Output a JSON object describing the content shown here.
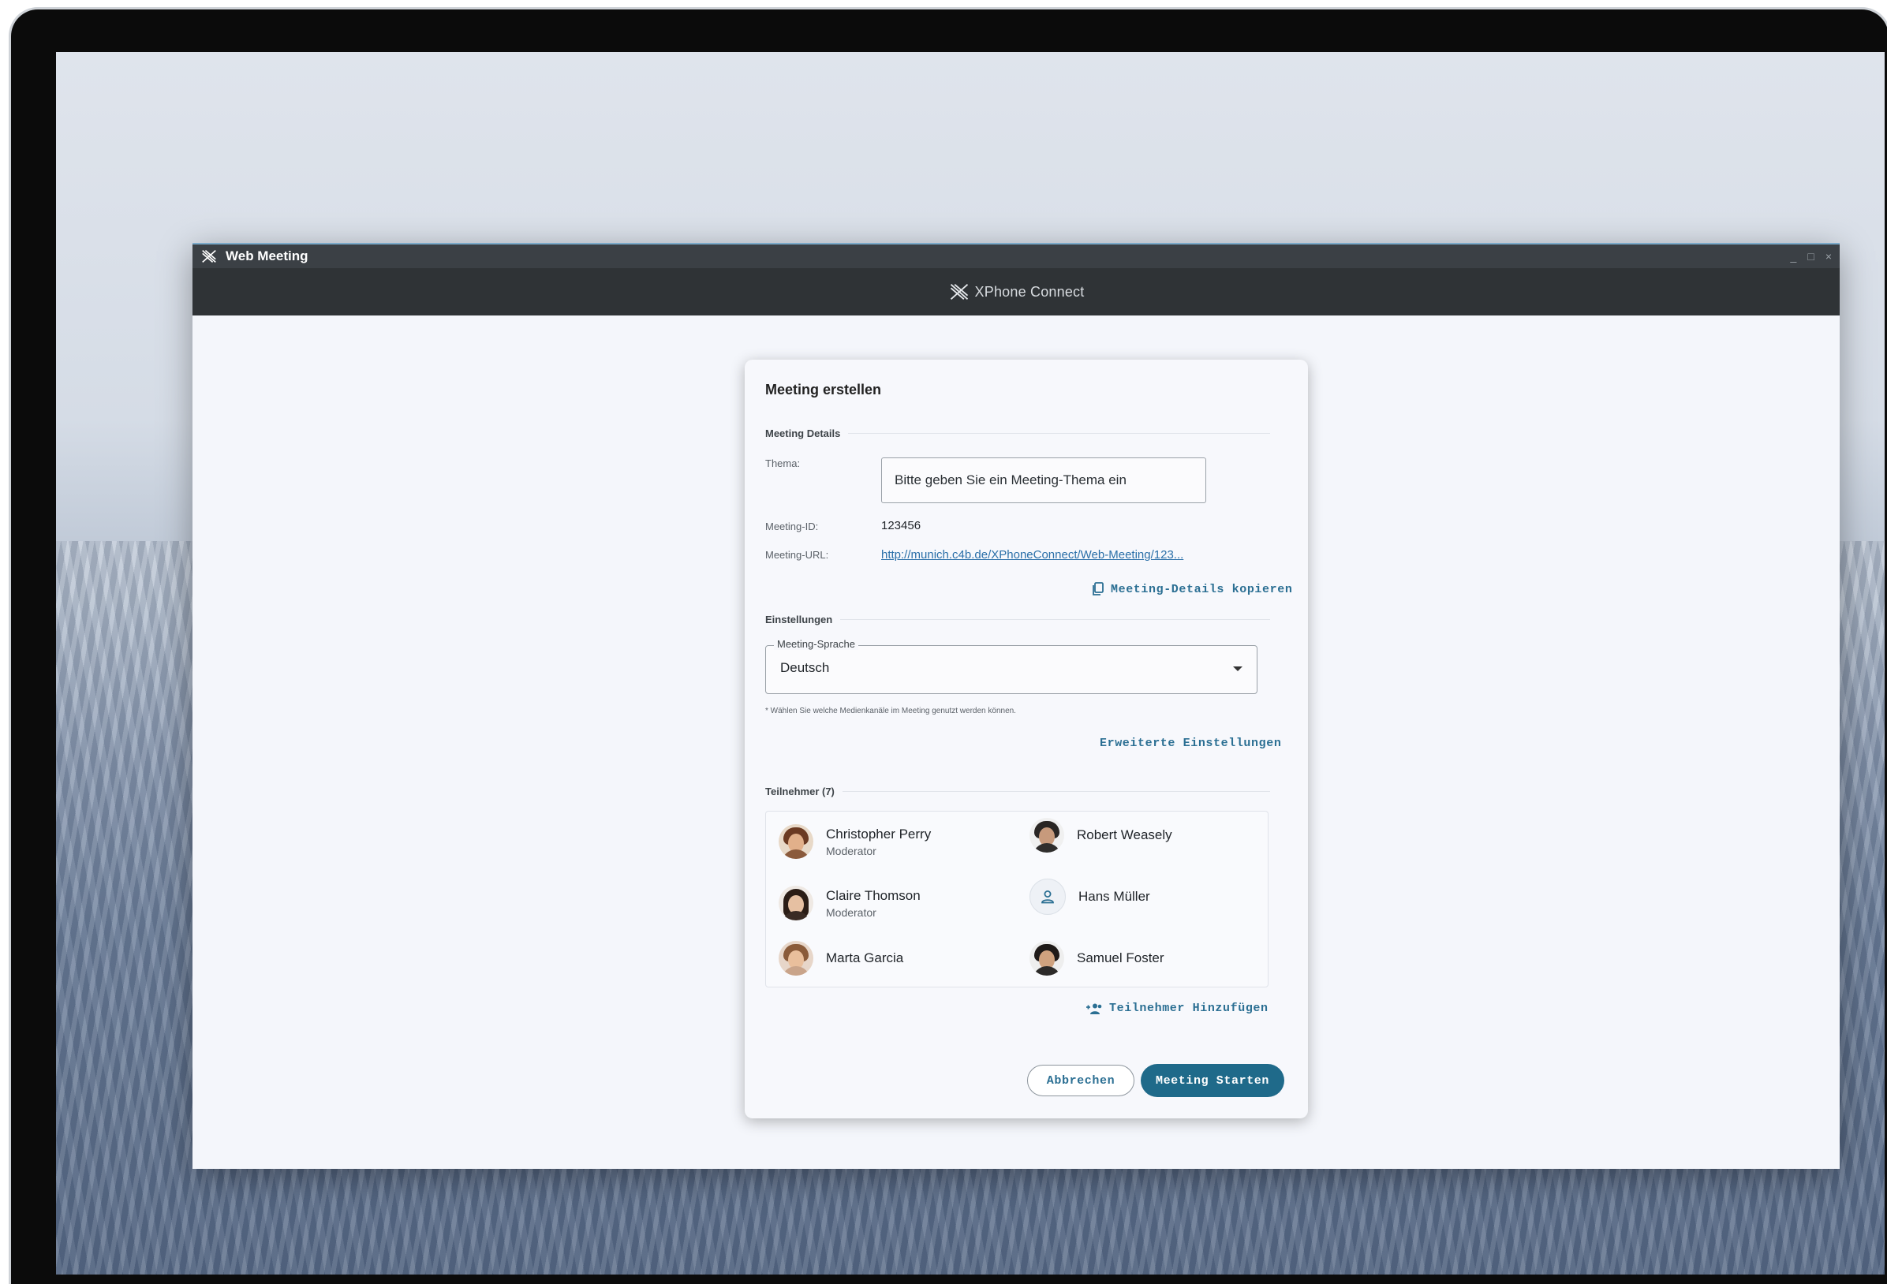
{
  "window": {
    "title": "Web Meeting",
    "brand": "XPhone Connect",
    "controls": [
      "_",
      "□",
      "×"
    ]
  },
  "dialog": {
    "title": "Meeting erstellen",
    "details": {
      "section_label": "Meeting Details",
      "thema_label": "Thema:",
      "thema_placeholder": "Bitte geben Sie ein Meeting-Thema ein",
      "thema_value": "",
      "meeting_id_label": "Meeting-ID:",
      "meeting_id_value": "123456",
      "meeting_url_label": "Meeting-URL:",
      "meeting_url_value": "http://munich.c4b.de/XPhoneConnect/Web-Meeting/123...",
      "copy_button": "Meeting-Details kopieren"
    },
    "settings": {
      "section_label": "Einstellungen",
      "language_label": "Meeting-Sprache",
      "language_value": "Deutsch",
      "hint": "* Wählen Sie welche Medienkanäle im Meeting genutzt werden können.",
      "advanced_button": "Erweiterte Einstellungen"
    },
    "participants": {
      "section_label": "Teilnehmer (7)",
      "list": [
        {
          "name": "Christopher Perry",
          "role": "Moderator"
        },
        {
          "name": "Robert Weasely",
          "role": ""
        },
        {
          "name": "Claire Thomson",
          "role": "Moderator"
        },
        {
          "name": "Hans Müller",
          "role": ""
        },
        {
          "name": "Marta Garcia",
          "role": ""
        },
        {
          "name": "Samuel Foster",
          "role": ""
        }
      ],
      "add_button": "Teilnehmer Hinzufügen"
    },
    "actions": {
      "cancel": "Abbrechen",
      "start": "Meeting Starten"
    }
  },
  "colors": {
    "accent": "#1f6a8a",
    "link": "#2a6fa8",
    "titlebar": "#3b4045",
    "brandbar": "#2f3336"
  },
  "icons": [
    "xphone-logo-icon",
    "copy-icon",
    "caret-down-icon",
    "person-icon",
    "add-people-icon"
  ]
}
